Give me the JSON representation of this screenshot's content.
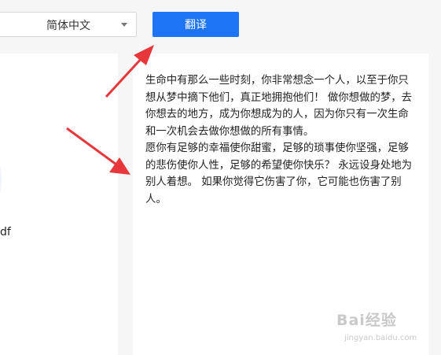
{
  "toolbar": {
    "language_select": {
      "value": "简体中文",
      "icon": "chevron-down-icon"
    },
    "translate_label": "翻译",
    "accent_color": "#1d74f5"
  },
  "left_panel": {
    "partial_text": "df"
  },
  "result_panel": {
    "text": "生命中有那么一些时刻，你非常想念一个人，以至于你只想从梦中摘下他们，真正地拥抱他们！ 做你想做的梦，去你想去的地方，成为你想成为的人，因为你只有一次生命和一次机会去做你想做的所有事情。\n愿你有足够的幸福使你甜蜜，足够的琐事使你坚强，足够的悲伤使你人性，足够的希望使你快乐？ 永远设身处地为别人着想。 如果你觉得它伤害了你，它可能也伤害了别人。"
  },
  "annotations": {
    "arrow_color": "#e8373b"
  },
  "watermark": {
    "brand": "Bai经验",
    "url": "jingyan.baidu.com"
  }
}
